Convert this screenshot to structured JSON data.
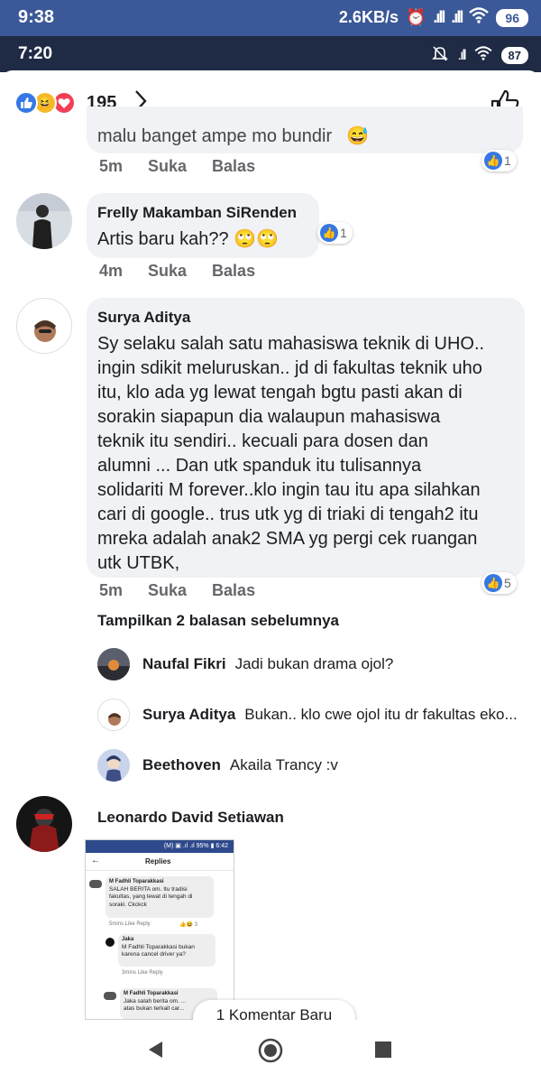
{
  "outer_status": {
    "time": "9:38",
    "speed": "2.6KB/s",
    "battery": "96"
  },
  "inner_status": {
    "time": "7:20",
    "battery": "87"
  },
  "reactions": {
    "count": "195",
    "icons": [
      "like-icon",
      "haha-icon",
      "love-icon"
    ],
    "chevron": "›"
  },
  "comments": [
    {
      "cut_text": "malu banget ampe mo bundir",
      "time": "5m",
      "like_label": "Suka",
      "reply_label": "Balas",
      "likes": "1"
    },
    {
      "name": "Frelly Makamban SiRenden",
      "text": "Artis baru kah?? 🙄🙄",
      "time": "4m",
      "like_label": "Suka",
      "reply_label": "Balas",
      "likes": "1"
    },
    {
      "name": "Surya Aditya",
      "lines": [
        "Sy selaku salah satu mahasiswa teknik di UHO..",
        "ingin sdikit meluruskan.. jd di fakultas teknik uho",
        "itu, klo ada yg lewat tengah bgtu pasti akan di",
        "sorakin siapapun dia walaupun mahasiswa",
        "teknik itu sendiri.. kecuali para dosen dan",
        "alumni ... Dan utk spanduk itu tulisannya",
        "solidariti M forever..klo ingin tau itu apa silahkan",
        "cari di google.. trus utk yg di triaki di tengah2 itu",
        "mreka adalah anak2 SMA yg pergi cek ruangan",
        "utk UTBK,"
      ],
      "time": "5m",
      "like_label": "Suka",
      "reply_label": "Balas",
      "likes": "5"
    }
  ],
  "previous_replies": "Tampilkan 2 balasan sebelumnya",
  "replies": [
    {
      "name": "Naufal Fikri",
      "text": "Jadi bukan drama ojol?"
    },
    {
      "name": "Surya Aditya",
      "text": "Bukan.. klo cwe ojol itu dr fakultas eko..."
    },
    {
      "name": "Beethoven",
      "text": "Akaila Trancy :v"
    }
  ],
  "last_comment": {
    "name": "Leonardo David Setiawan"
  },
  "embedded": {
    "status": "(M) ▣ .ıl .ıl 95% ▮ 6:42",
    "title": "Replies",
    "c1_name": "M Fadhli Toparakkasi",
    "c1_lines": [
      "SALAH BERITA om. Itu tradisi",
      "fakultas, yang lewat di tengah di",
      "soraki. Ckckck"
    ],
    "c1_meta": "5mins   Like   Reply",
    "c1_react": "3",
    "c2_name": "Jaka",
    "c2_lines": [
      "M Fadhli Toparakkasi bukan",
      "karena cancel driver ya?"
    ],
    "c2_meta": "3mins   Like   Reply",
    "c3_name": "M Fadhli Toparakkasi",
    "c3_lines": [
      "Jaka salah berita om. ...",
      "atas bukan terkait car..."
    ]
  },
  "new_comment_pill": "1 Komentar Baru",
  "nav": {
    "back": "back-icon",
    "home": "home-icon",
    "recents": "recents-icon"
  }
}
